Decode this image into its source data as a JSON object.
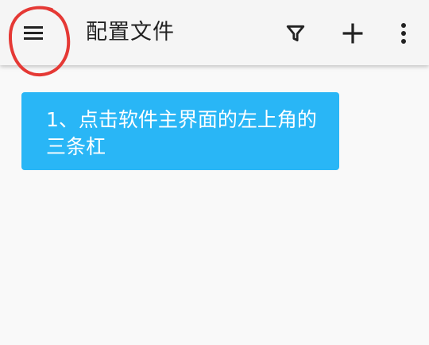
{
  "toolbar": {
    "title": "配置文件",
    "menu_icon": "hamburger-menu-icon",
    "filter_icon": "filter-icon",
    "add_icon": "plus-icon",
    "more_icon": "more-vertical-icon"
  },
  "callout": {
    "text": "1、点击软件主界面的左上角的三条杠"
  },
  "colors": {
    "toolbar_bg": "#f5f5f5",
    "page_bg": "#f9f9f9",
    "callout_bg": "#29b6f6",
    "annotation": "#e53935"
  }
}
